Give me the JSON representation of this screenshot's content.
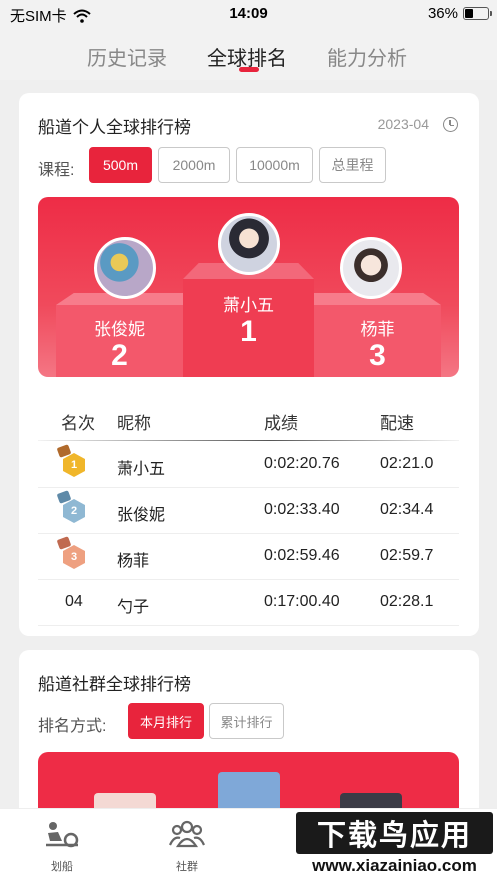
{
  "status_bar": {
    "carrier": "无SIM卡",
    "time": "14:09",
    "battery": "36%",
    "battery_level": 0.36
  },
  "tabs": [
    {
      "label": "历史记录",
      "active": false
    },
    {
      "label": "全球排名",
      "active": true
    },
    {
      "label": "能力分析",
      "active": false
    }
  ],
  "personal_board": {
    "title": "船道个人全球排行榜",
    "date": "2023-04",
    "course_label": "课程:",
    "courses": [
      {
        "label": "500m",
        "active": true
      },
      {
        "label": "2000m",
        "active": false
      },
      {
        "label": "10000m",
        "active": false
      },
      {
        "label": "总里程",
        "active": false
      }
    ],
    "podium": {
      "first": {
        "name": "萧小五",
        "rank": "1"
      },
      "second": {
        "name": "张俊妮",
        "rank": "2"
      },
      "third": {
        "name": "杨菲",
        "rank": "3"
      }
    },
    "table": {
      "headers": [
        "名次",
        "昵称",
        "成绩",
        "配速"
      ],
      "rows": [
        {
          "rank": "1",
          "medal": "gold",
          "name": "萧小五",
          "score": "0:02:20.76",
          "pace": "02:21.0"
        },
        {
          "rank": "2",
          "medal": "silver",
          "name": "张俊妮",
          "score": "0:02:33.40",
          "pace": "02:34.4"
        },
        {
          "rank": "3",
          "medal": "bronze",
          "name": "杨菲",
          "score": "0:02:59.46",
          "pace": "02:59.7"
        },
        {
          "rank": "04",
          "medal": null,
          "name": "勺子",
          "score": "0:17:00.40",
          "pace": "02:28.1"
        }
      ]
    }
  },
  "community_board": {
    "title": "船道社群全球排行榜",
    "sort_label": "排名方式:",
    "sorts": [
      {
        "label": "本月排行",
        "active": true
      },
      {
        "label": "累计排行",
        "active": false
      }
    ]
  },
  "bottom_nav": [
    {
      "label": "划船",
      "icon": "rowing-icon"
    },
    {
      "label": "社群",
      "icon": "community-icon"
    }
  ],
  "watermark": {
    "text": "下载鸟应用",
    "url": "www.xiazainiao.com"
  },
  "colors": {
    "accent": "#e8243c"
  }
}
